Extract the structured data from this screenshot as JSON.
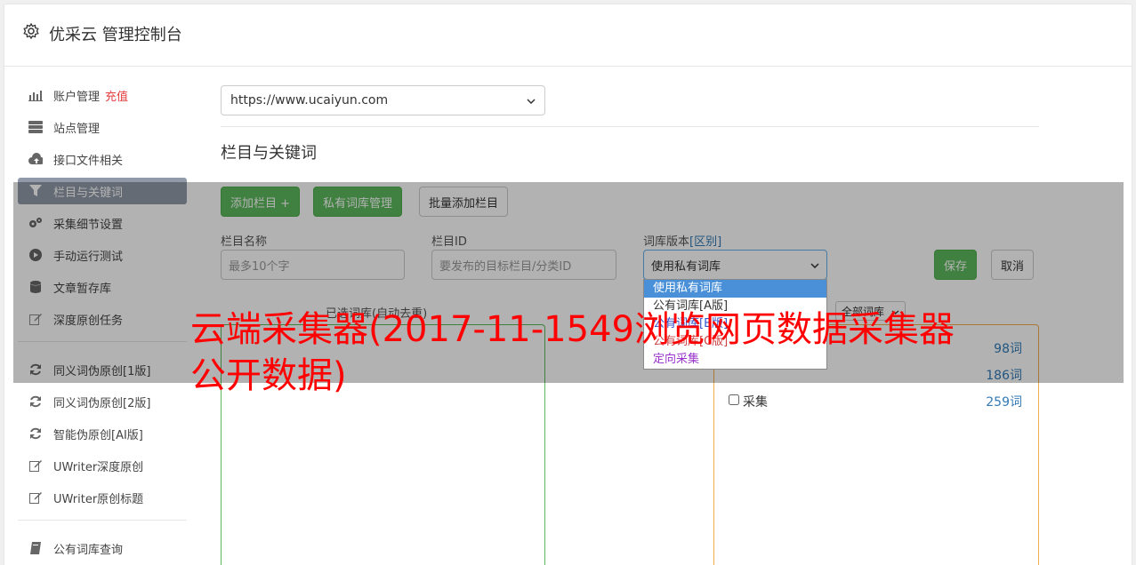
{
  "header": {
    "title": "优采云 管理控制台"
  },
  "sidebar": {
    "items": [
      {
        "label": "账户管理",
        "badge": "充值",
        "icon": "bar-chart-icon"
      },
      {
        "label": "站点管理",
        "icon": "server-icon"
      },
      {
        "label": "接口文件相关",
        "icon": "cloud-upload-icon"
      },
      {
        "label": "栏目与关键词",
        "icon": "filter-icon",
        "active": true
      },
      {
        "label": "采集细节设置",
        "icon": "gears-icon"
      },
      {
        "label": "手动运行测试",
        "icon": "play-circle-icon"
      },
      {
        "label": "文章暂存库",
        "icon": "database-icon"
      },
      {
        "label": "深度原创任务",
        "icon": "edit-icon"
      }
    ],
    "items2": [
      {
        "label": "同义词伪原创[1版]",
        "icon": "refresh-icon"
      },
      {
        "label": "同义词伪原创[2版]",
        "icon": "refresh-icon"
      },
      {
        "label": "智能伪原创[AI版]",
        "icon": "refresh-icon"
      },
      {
        "label": "UWriter深度原创",
        "icon": "edit-icon"
      },
      {
        "label": "UWriter原创标题",
        "icon": "edit-icon"
      }
    ],
    "items3": [
      {
        "label": "公有词库查询",
        "icon": "book-icon"
      }
    ]
  },
  "main": {
    "site_select": "https://www.ucaiyun.com",
    "section_title": "栏目与关键词",
    "buttons": {
      "add_column": "添加栏目 +",
      "private_lib": "私有词库管理",
      "batch_add": "批量添加栏目",
      "save": "保存",
      "cancel": "取消"
    },
    "fields": {
      "name_label": "栏目名称",
      "name_placeholder": "最多10个字",
      "id_label": "栏目ID",
      "id_placeholder": "要发布的目标栏目/分类ID",
      "version_label": "词库版本",
      "version_link": "[区别]",
      "version_value": "使用私有词库"
    },
    "dropdown_options": [
      "使用私有词库",
      "公有词库[A版]",
      "公有词库[B版]",
      "公有词库[C版]",
      "定向采集"
    ],
    "selected_words_label": "已选词库(自动去重)",
    "lib_select": "全部词库",
    "right_rows": [
      {
        "name": "",
        "count": "98词"
      },
      {
        "name": "",
        "count": "186词"
      },
      {
        "name": "采集",
        "count": "259词"
      }
    ]
  },
  "watermark": "云端采集器(2017-11-1549浏览网页数据采集器公开数据)",
  "colors": {
    "green": "#5cb85c",
    "orange": "#f0ad4e",
    "blue": "#337ab7",
    "red": "#e53e3e"
  }
}
